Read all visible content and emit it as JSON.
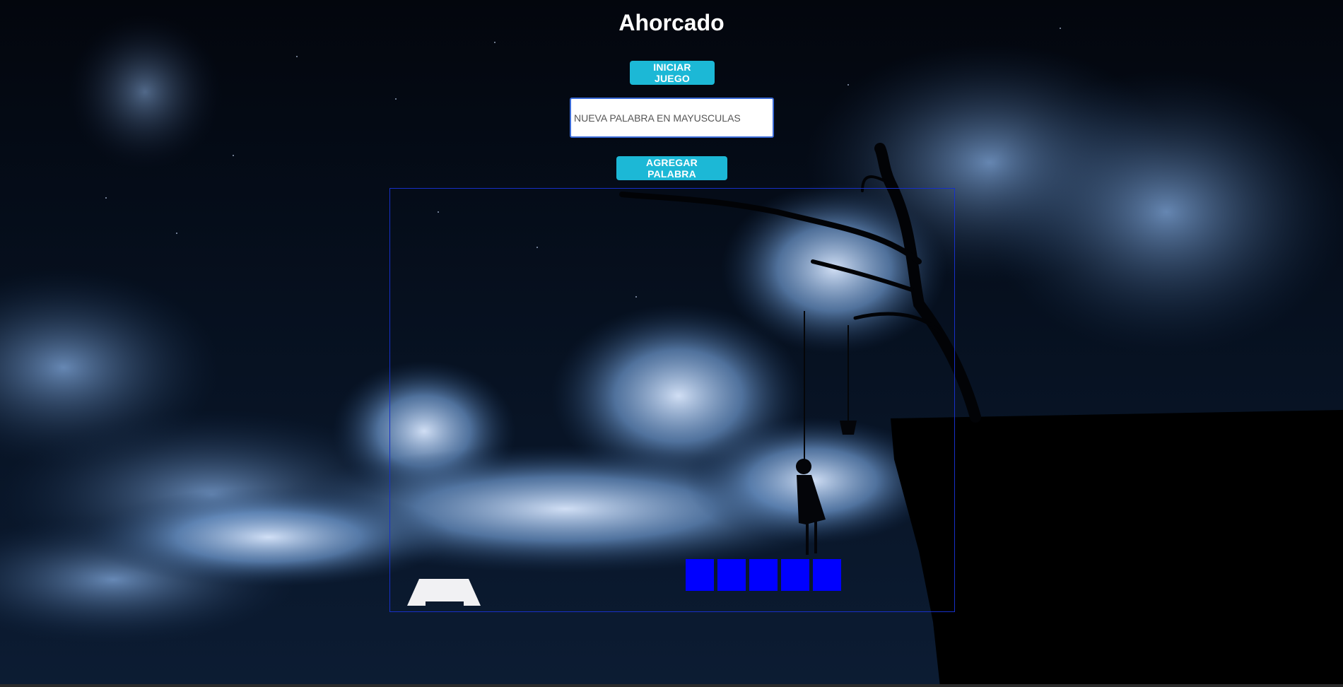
{
  "header": {
    "title": "Ahorcado"
  },
  "controls": {
    "start_label": "INICIAR JUEGO",
    "input_placeholder": "NUEVA PALABRA EN MAYUSCULAS",
    "input_value": "",
    "add_label": "AGREGAR PALABRA"
  },
  "game": {
    "slots": 5
  },
  "colors": {
    "button": "#1cb8d6",
    "slot": "#0000ff",
    "board_border": "#1730c8"
  }
}
